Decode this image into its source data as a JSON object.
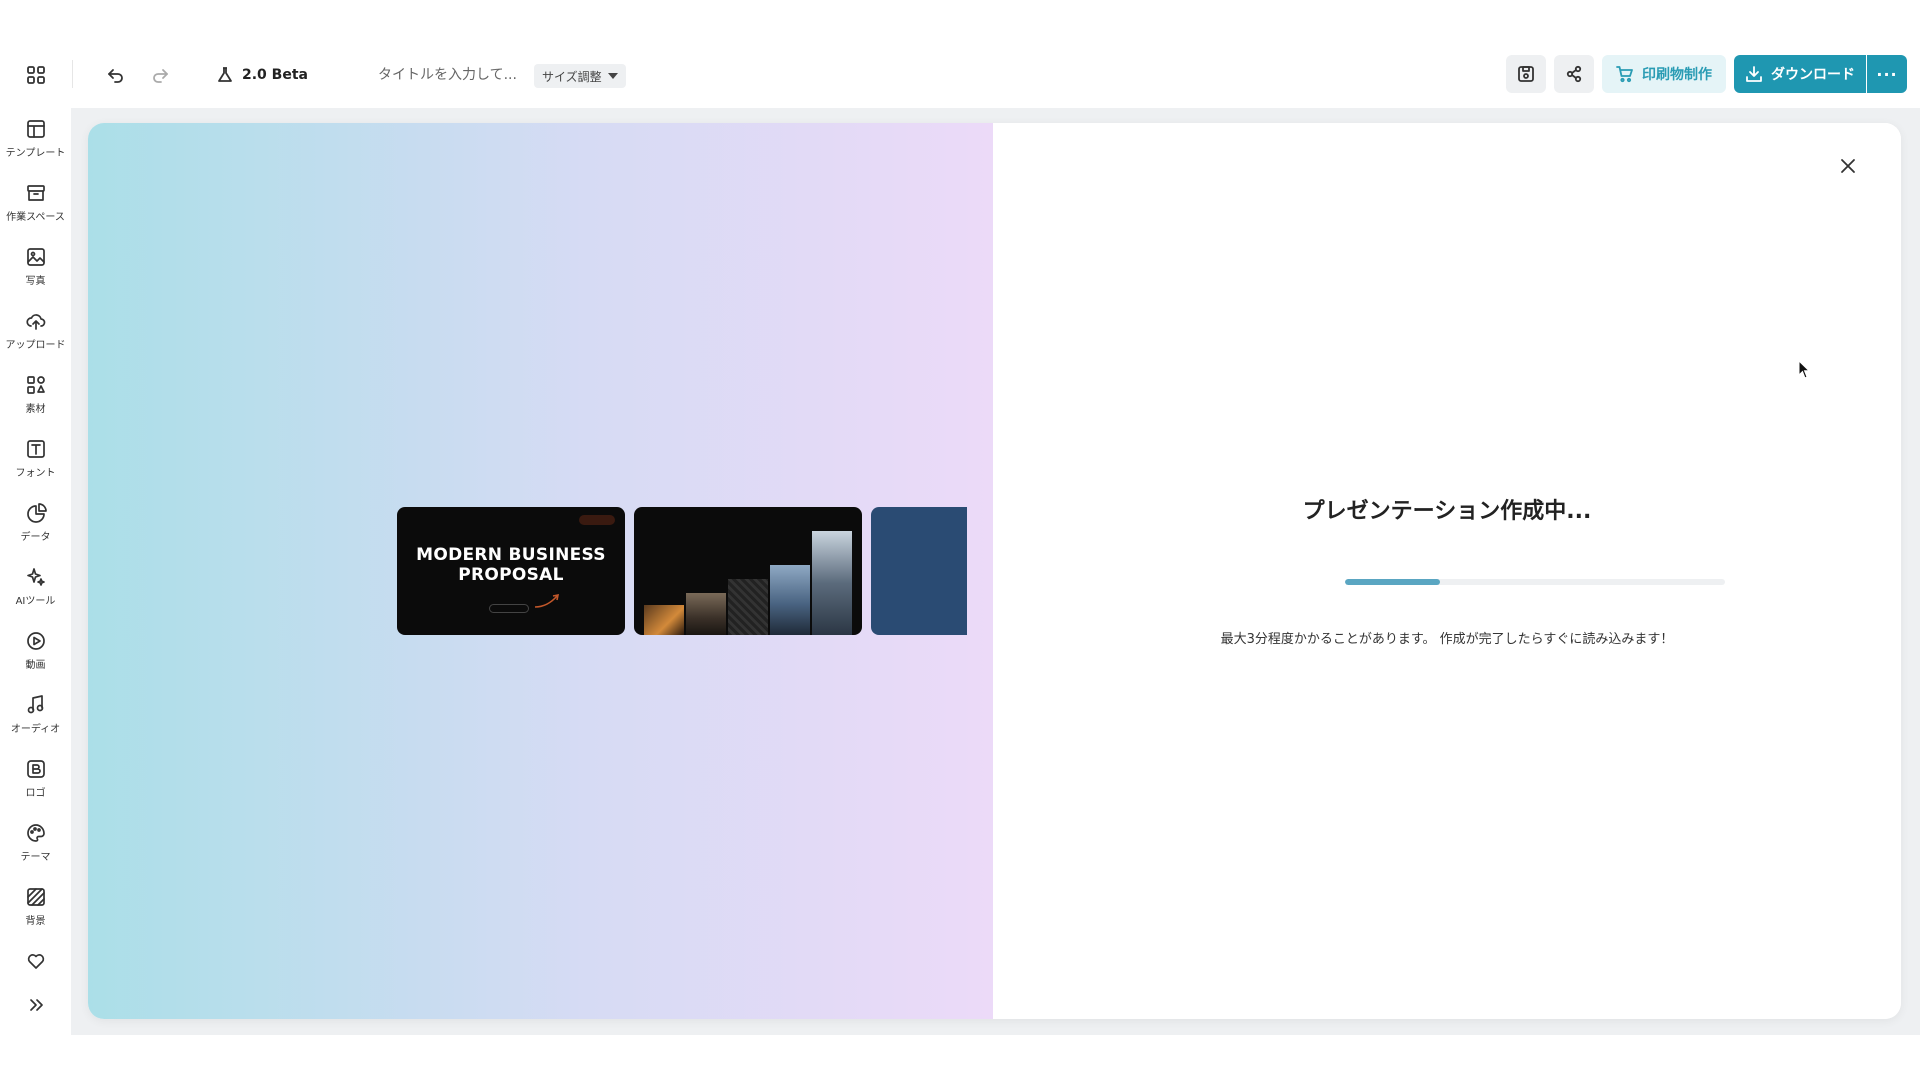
{
  "header": {
    "beta_label": "2.0 Beta",
    "title_placeholder": "タイトルを入力して...",
    "size_label": "サイズ調整",
    "print_label": "印刷物制作",
    "download_label": "ダウンロード",
    "more_label": "···"
  },
  "sidebar": {
    "items": [
      {
        "label": "テンプレート",
        "icon": "template-icon"
      },
      {
        "label": "作業スペース",
        "icon": "workspace-icon"
      },
      {
        "label": "写真",
        "icon": "photo-icon"
      },
      {
        "label": "アップロード",
        "icon": "upload-icon"
      },
      {
        "label": "素材",
        "icon": "elements-icon"
      },
      {
        "label": "フォント",
        "icon": "font-icon"
      },
      {
        "label": "データ",
        "icon": "data-icon"
      },
      {
        "label": "AIツール",
        "icon": "ai-tool-icon"
      },
      {
        "label": "動画",
        "icon": "video-icon"
      },
      {
        "label": "オーディオ",
        "icon": "audio-icon"
      },
      {
        "label": "ロゴ",
        "icon": "logo-icon"
      },
      {
        "label": "テーマ",
        "icon": "theme-icon"
      },
      {
        "label": "背景",
        "icon": "background-icon"
      }
    ]
  },
  "preview": {
    "slide1_title_line1": "MODERN BUSINESS",
    "slide1_title_line2": "PROPOSAL"
  },
  "loading": {
    "title": "プレゼンテーション作成中...",
    "progress": 0.25,
    "note": "最大3分程度かかることがあります。 作成が完了したらすぐに読み込みます！"
  },
  "colors": {
    "accent": "#1f97b1",
    "progress": "#5aa6c2"
  }
}
